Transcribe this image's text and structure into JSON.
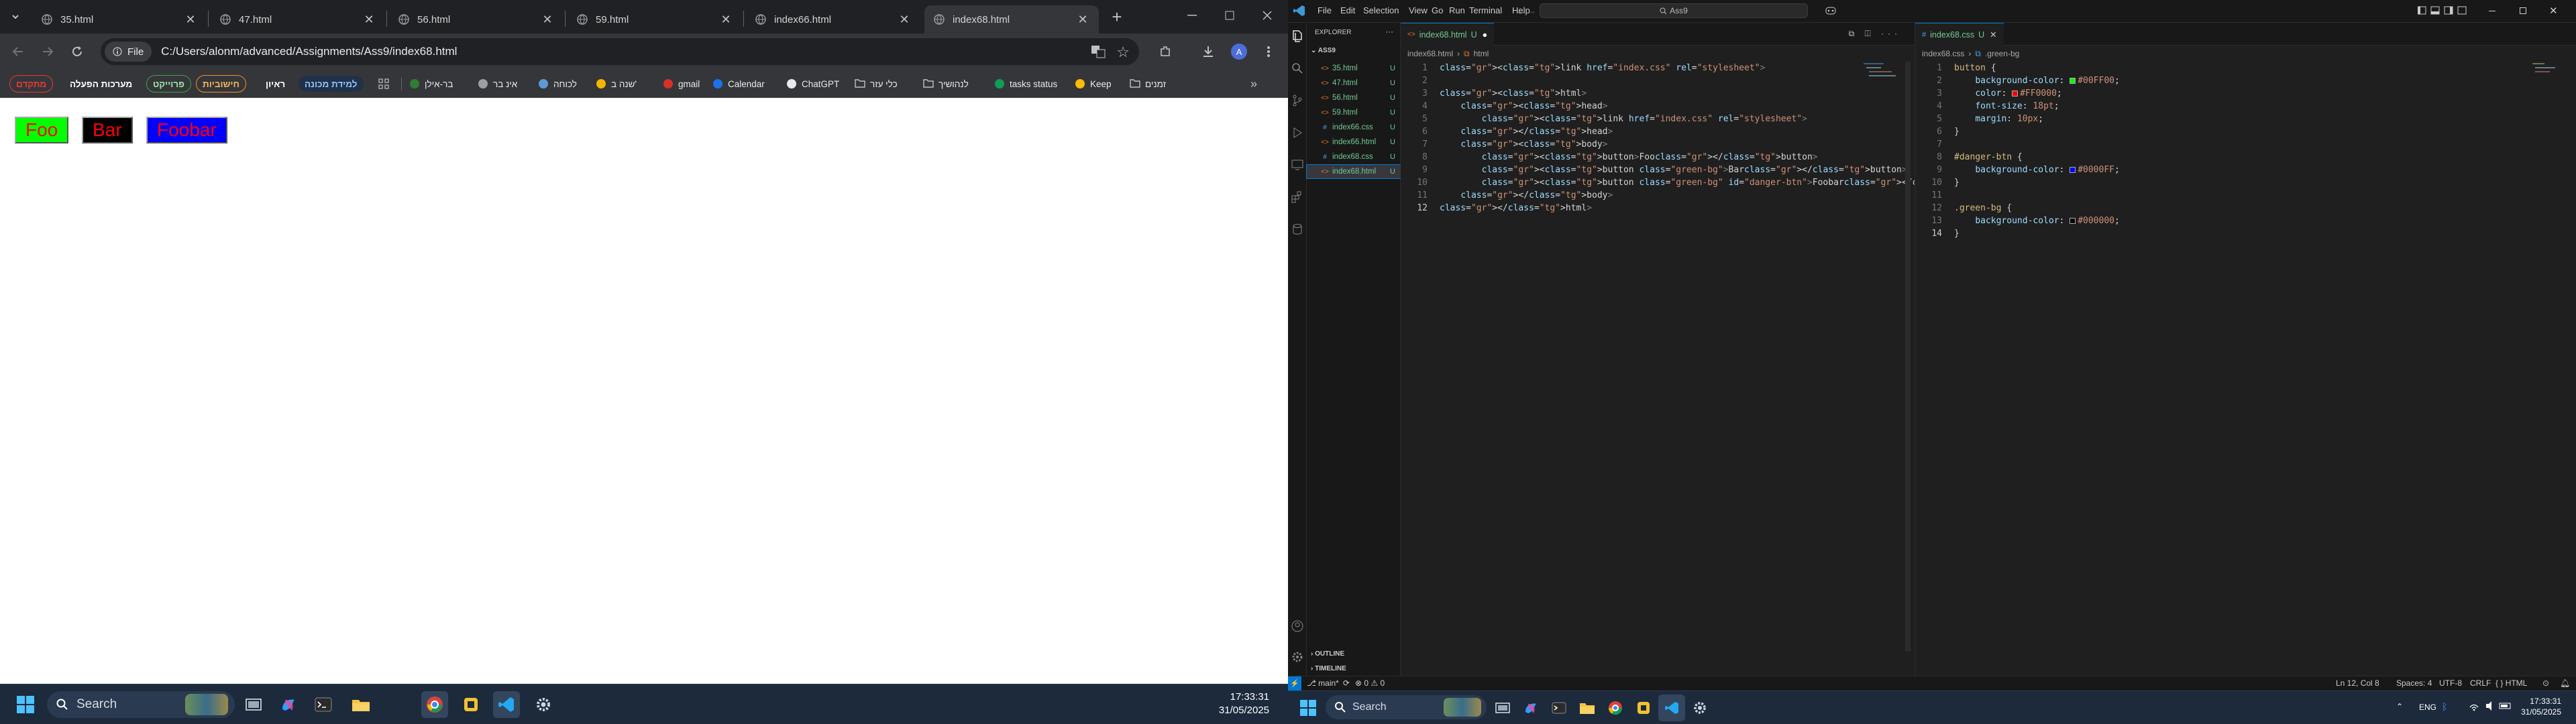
{
  "browser": {
    "tabs": [
      {
        "title": "35.html"
      },
      {
        "title": "47.html"
      },
      {
        "title": "56.html"
      },
      {
        "title": "59.html"
      },
      {
        "title": "index66.html"
      },
      {
        "title": "index68.html",
        "active": true
      }
    ],
    "address": {
      "chip_label": "File",
      "url": "C:/Users/alonm/advanced/Assignments/Ass9/index68.html"
    },
    "profile_initial": "A",
    "bookmarks": [
      {
        "label": "מתקדם",
        "style": "pill-red"
      },
      {
        "label": "מערכות הפעלה",
        "style": "pill-dark"
      },
      {
        "label": "פרוייקט",
        "style": "pill-green"
      },
      {
        "label": "חישוביות",
        "style": "pill-orange"
      },
      {
        "label": "ראיון",
        "style": "pill-dark"
      },
      {
        "label": "למידת מכונה",
        "style": "pill-blue"
      },
      {
        "label": "בר-אילן",
        "icon": "bar-ilan-icon"
      },
      {
        "label": "אינ בר",
        "icon": "globe-icon"
      },
      {
        "label": "לכוחה",
        "icon": "kolzchut-icon"
      },
      {
        "label": "שנה ב'",
        "icon": "drive-icon"
      },
      {
        "label": "gmail",
        "icon": "gmail-icon"
      },
      {
        "label": "Calendar",
        "icon": "calendar-icon"
      },
      {
        "label": "ChatGPT",
        "icon": "chatgpt-icon"
      },
      {
        "label": "כלי עזר",
        "icon": "folder-icon"
      },
      {
        "label": "לנהושיך",
        "icon": "folder-icon"
      },
      {
        "label": "tasks status",
        "icon": "sheets-icon"
      },
      {
        "label": "Keep",
        "icon": "keep-icon"
      },
      {
        "label": "זמנים",
        "icon": "folder-icon"
      }
    ],
    "page_buttons": [
      {
        "label": "Foo",
        "bg": "#00FF00",
        "color": "#FF0000"
      },
      {
        "label": "Bar",
        "bg": "#000000",
        "color": "#FF0000"
      },
      {
        "label": "Foobar",
        "bg": "#0000FF",
        "color": "#FF0000"
      }
    ]
  },
  "taskbar": {
    "search_label": "Search",
    "left_time": "17:33:31",
    "left_date": "31/05/2025",
    "right_time": "17:33:31",
    "right_date": "31/05/2025",
    "lang": "ENG"
  },
  "vscode": {
    "menu": [
      "File",
      "Edit",
      "Selection",
      "View",
      "Go",
      "Run",
      "Terminal",
      "Help"
    ],
    "search_placeholder": "Ass9",
    "explorer_title": "EXPLORER",
    "folder": "ASS9",
    "files": [
      {
        "name": "35.html",
        "type": "html",
        "status": "U"
      },
      {
        "name": "47.html",
        "type": "html",
        "status": "U"
      },
      {
        "name": "56.html",
        "type": "html",
        "status": "U"
      },
      {
        "name": "59.html",
        "type": "html",
        "status": "U"
      },
      {
        "name": "index66.css",
        "type": "css",
        "status": "U"
      },
      {
        "name": "index66.html",
        "type": "html",
        "status": "U"
      },
      {
        "name": "index68.css",
        "type": "css",
        "status": "U"
      },
      {
        "name": "index68.html",
        "type": "html",
        "status": "U",
        "selected": true
      }
    ],
    "outline_label": "OUTLINE",
    "timeline_label": "TIMELINE",
    "editor1": {
      "tab": "index68.html",
      "tab_status": "U",
      "crumbs": [
        "index68.html",
        "html"
      ],
      "lines": [
        "<link href=\"index.css\" rel=\"stylesheet\">",
        "",
        "<html>",
        "    <head>",
        "        <link href=\"index.css\" rel=\"stylesheet\">",
        "    </head>",
        "    <body>",
        "        <button>Foo</button>",
        "        <button class=\"green-bg\">Bar</button>",
        "        <button class=\"green-bg\" id=\"danger-btn\">Foobar</button>",
        "    </body>",
        "</html>"
      ]
    },
    "editor2": {
      "tab": "index68.css",
      "tab_status": "U",
      "crumbs": [
        "index68.css",
        ".green-bg"
      ],
      "lines": [
        "button {",
        "    background-color: #00FF00;",
        "    color: #FF0000;",
        "    font-size: 18pt;",
        "    margin: 10px;",
        "}",
        "",
        "#danger-btn {",
        "    background-color: #0000FF;",
        "}",
        "",
        ".green-bg {",
        "    background-color: #000000;",
        "}"
      ]
    },
    "status": {
      "branch": "main*",
      "problems": "0",
      "warnings": "0",
      "position": "Ln 12, Col 8",
      "spaces": "Spaces: 4",
      "encoding": "UTF-8",
      "eol": "CRLF",
      "language": "HTML"
    }
  }
}
